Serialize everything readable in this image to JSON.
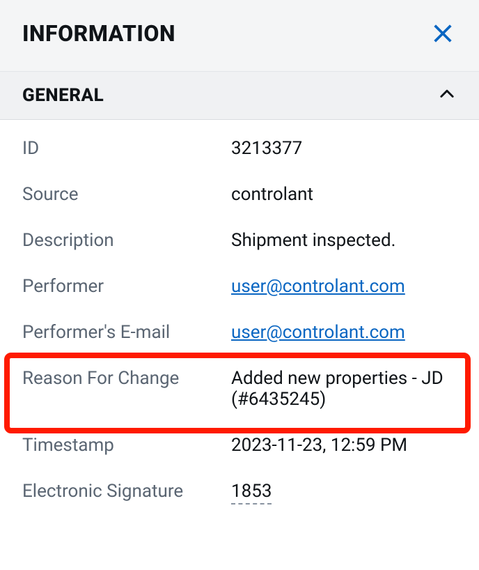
{
  "header": {
    "title": "INFORMATION"
  },
  "section": {
    "title": "GENERAL"
  },
  "fields": {
    "id": {
      "label": "ID",
      "value": "3213377"
    },
    "source": {
      "label": "Source",
      "value": "controlant"
    },
    "description": {
      "label": "Description",
      "value": "Shipment inspected."
    },
    "performer": {
      "label": "Performer",
      "value": "user@controlant.com"
    },
    "performer_email": {
      "label": "Performer's E-mail",
      "value": "user@controlant.com"
    },
    "reason_for_change": {
      "label": "Reason For Change",
      "value": "Added new properties - JD (#6435245)"
    },
    "timestamp": {
      "label": "Timestamp",
      "value": "2023-11-23, 12:59 PM"
    },
    "electronic_signature": {
      "label": "Electronic Signature",
      "value": "1853"
    }
  }
}
